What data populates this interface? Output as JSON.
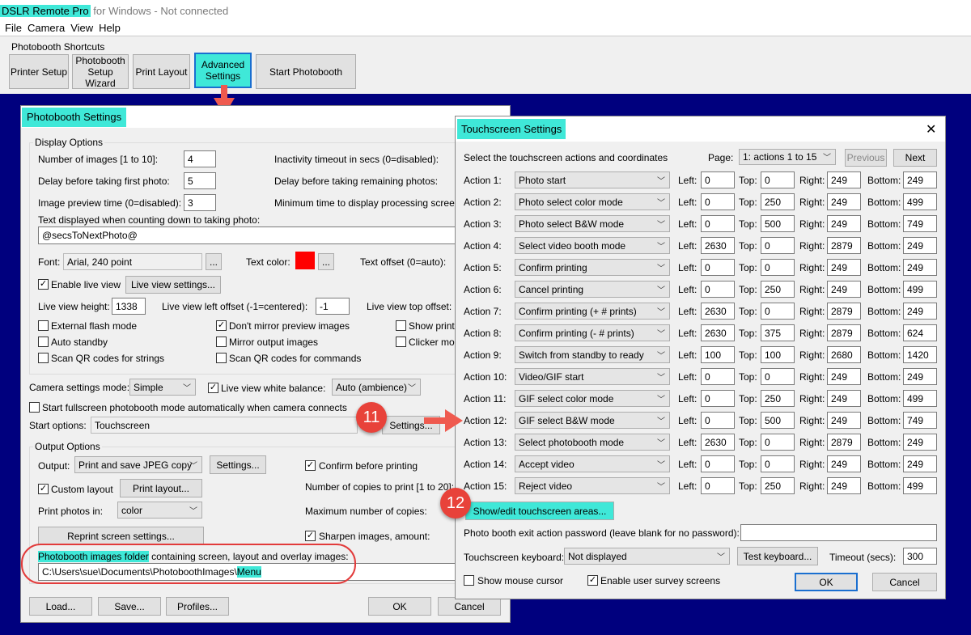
{
  "window": {
    "title_app": "DSLR Remote Pro",
    "title_rest": "for Windows - Not connected"
  },
  "menu": [
    "File",
    "Camera",
    "View",
    "Help"
  ],
  "shortcuts": {
    "label": "Photobooth Shortcuts",
    "buttons": [
      {
        "label": "Printer Setup"
      },
      {
        "label": "Photobooth Setup Wizard"
      },
      {
        "label": "Print Layout"
      },
      {
        "label": "Advanced Settings"
      },
      {
        "label": "Start Photobooth"
      }
    ]
  },
  "callouts": [
    "11",
    "12"
  ],
  "photobooth_settings": {
    "title": "Photobooth Settings",
    "display_options": {
      "group": "Display Options",
      "num_images": {
        "label": "Number of images [1 to 10]:",
        "value": "4"
      },
      "delay_first": {
        "label": "Delay before taking first photo:",
        "value": "5"
      },
      "preview_time": {
        "label": "Image preview time (0=disabled):",
        "value": "3"
      },
      "inactivity": "Inactivity timeout in secs (0=disabled):",
      "delay_remaining": "Delay before taking remaining photos:",
      "min_processing": "Minimum time to display processing screen:",
      "countdown_label": "Text displayed when counting down to taking photo:",
      "countdown_value": "@secsToNextPhoto@",
      "font_label": "Font:",
      "font_value": "Arial, 240 point",
      "ellipsis": "...",
      "text_color": "Text color:",
      "text_color_value": "#ff0000",
      "text_offset": "Text offset (0=auto):",
      "enable_live_view": "Enable live view",
      "live_view_settings": "Live view settings...",
      "live_view_height": {
        "label": "Live view height:",
        "value": "1338"
      },
      "live_view_left": {
        "label": "Live view left offset (-1=centered):",
        "value": "-1"
      },
      "live_view_top": "Live view top offset:",
      "external_flash": "External flash mode",
      "auto_standby": "Auto standby",
      "scan_qr_strings": "Scan QR codes for strings",
      "dont_mirror": "Don't mirror preview images",
      "mirror_output": "Mirror output images",
      "scan_qr_commands": "Scan QR codes for commands",
      "show_print": "Show print",
      "clicker_mode": "Clicker mod"
    },
    "camera_settings_mode": {
      "label": "Camera settings mode:",
      "value": "Simple"
    },
    "live_view_wb": {
      "label": "Live view white balance:",
      "value": "Auto (ambience)"
    },
    "start_fullscreen": "Start fullscreen photobooth mode automatically when camera connects",
    "start_options": {
      "label": "Start options:",
      "value": "Touchscreen",
      "button": "Settings..."
    },
    "output_options": {
      "group": "Output Options",
      "output_label": "Output:",
      "output_value": "Print and save JPEG copy",
      "settings": "Settings...",
      "confirm_printing": "Confirm before printing",
      "custom_layout": "Custom layout",
      "print_layout": "Print layout...",
      "copies": "Number of copies to print [1 to 20]:",
      "print_photos_in": "Print photos in:",
      "print_photos_value": "color",
      "max_copies": "Maximum number of copies:",
      "reprint": "Reprint screen settings...",
      "sharpen": "Sharpen images, amount:"
    },
    "images_folder": {
      "label_hl": "Photobooth images folder",
      "label_rest": "containing screen, layout and overlay images:",
      "path": "C:\\Users\\sue\\Documents\\PhotoboothImages\\",
      "path_hl": "Menu"
    },
    "footer": {
      "load": "Load...",
      "save": "Save...",
      "profiles": "Profiles...",
      "ok": "OK",
      "cancel": "Cancel"
    }
  },
  "touchscreen_settings": {
    "title": "Touchscreen Settings",
    "close": "✕",
    "intro": "Select the touchscreen actions and coordinates",
    "page_label": "Page:",
    "page_value": "1: actions 1 to 15",
    "previous": "Previous",
    "next": "Next",
    "left": "Left:",
    "top": "Top:",
    "right": "Right:",
    "bottom": "Bottom:",
    "actions": [
      {
        "label": "Action 1:",
        "action": "Photo start",
        "left": "0",
        "top": "0",
        "right": "249",
        "bottom": "249"
      },
      {
        "label": "Action 2:",
        "action": "Photo select color mode",
        "left": "0",
        "top": "250",
        "right": "249",
        "bottom": "499"
      },
      {
        "label": "Action 3:",
        "action": "Photo select B&W mode",
        "left": "0",
        "top": "500",
        "right": "249",
        "bottom": "749"
      },
      {
        "label": "Action 4:",
        "action": "Select video booth mode",
        "left": "2630",
        "top": "0",
        "right": "2879",
        "bottom": "249"
      },
      {
        "label": "Action 5:",
        "action": "Confirm printing",
        "left": "0",
        "top": "0",
        "right": "249",
        "bottom": "249"
      },
      {
        "label": "Action 6:",
        "action": "Cancel printing",
        "left": "0",
        "top": "250",
        "right": "249",
        "bottom": "499"
      },
      {
        "label": "Action 7:",
        "action": "Confirm printing (+ # prints)",
        "left": "2630",
        "top": "0",
        "right": "2879",
        "bottom": "249"
      },
      {
        "label": "Action 8:",
        "action": "Confirm printing (- # prints)",
        "left": "2630",
        "top": "375",
        "right": "2879",
        "bottom": "624"
      },
      {
        "label": "Action 9:",
        "action": "Switch from standby to ready",
        "left": "100",
        "top": "100",
        "right": "2680",
        "bottom": "1420"
      },
      {
        "label": "Action 10:",
        "action": "Video/GIF start",
        "left": "0",
        "top": "0",
        "right": "249",
        "bottom": "249"
      },
      {
        "label": "Action 11:",
        "action": "GIF select color mode",
        "left": "0",
        "top": "250",
        "right": "249",
        "bottom": "499"
      },
      {
        "label": "Action 12:",
        "action": "GIF select B&W mode",
        "left": "0",
        "top": "500",
        "right": "249",
        "bottom": "749"
      },
      {
        "label": "Action 13:",
        "action": "Select photobooth mode",
        "left": "2630",
        "top": "0",
        "right": "2879",
        "bottom": "249"
      },
      {
        "label": "Action 14:",
        "action": "Accept video",
        "left": "0",
        "top": "0",
        "right": "249",
        "bottom": "249"
      },
      {
        "label": "Action 15:",
        "action": "Reject video",
        "left": "0",
        "top": "250",
        "right": "249",
        "bottom": "499"
      }
    ],
    "show_edit": "Show/edit touchscreen areas...",
    "exit_password": "Photo booth exit action password (leave blank for no password):",
    "exit_password_value": "",
    "keyboard_label": "Touchscreen keyboard:",
    "keyboard_value": "Not displayed",
    "test_keyboard": "Test keyboard...",
    "timeout_label": "Timeout (secs):",
    "timeout_value": "300",
    "show_mouse": "Show mouse cursor",
    "enable_survey": "Enable user survey screens",
    "ok": "OK",
    "cancel": "Cancel"
  }
}
